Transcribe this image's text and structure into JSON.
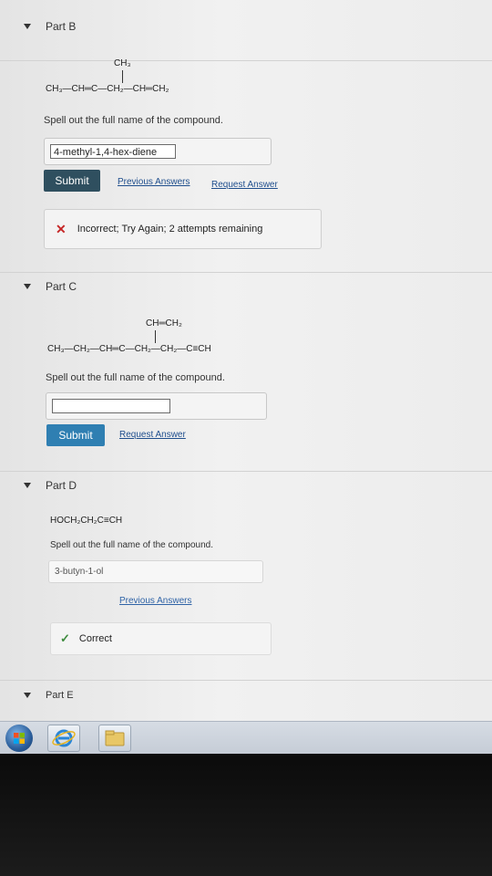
{
  "partB": {
    "title": "Part B",
    "branch": "CH₃",
    "chain": "CH₃—CH═C—CH₂—CH═CH₂",
    "question": "Spell out the full name of the compound.",
    "answer": "4-methyl-1,4-hex-diene",
    "submit": "Submit",
    "previous": "Previous Answers",
    "request": "Request Answer",
    "feedback": "Incorrect; Try Again; 2 attempts remaining"
  },
  "partC": {
    "title": "Part C",
    "branch": "CH═CH₂",
    "chain": "CH₃—CH₂—CH═C—CH₂—CH₂—C≡CH",
    "question": "Spell out the full name of the compound.",
    "answer": "",
    "submit": "Submit",
    "request": "Request Answer"
  },
  "partD": {
    "title": "Part D",
    "formula": "HOCH₂CH₂C≡CH",
    "question": "Spell out the full name of the compound.",
    "answer": "3-butyn-1-ol",
    "previous": "Previous Answers",
    "feedback": "Correct"
  },
  "partE": {
    "title": "Part E"
  },
  "colors": {
    "submit_dark": "#2f4f5f",
    "submit_blue": "#2f7fb2",
    "link": "#1f4e8d",
    "incorrect": "#c62828",
    "correct": "#3d8b3d"
  }
}
